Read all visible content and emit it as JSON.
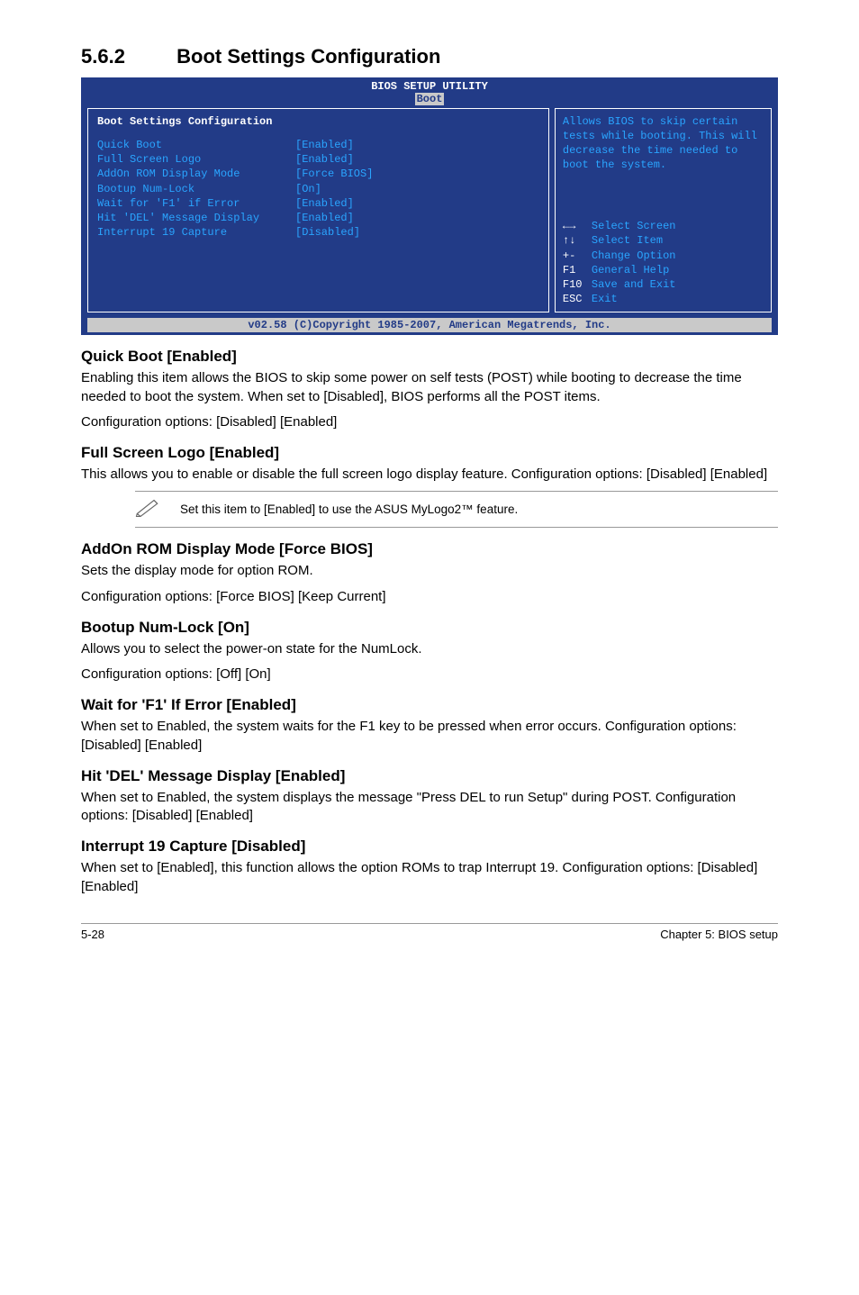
{
  "heading": {
    "number": "5.6.2",
    "title": "Boot Settings Configuration"
  },
  "bios": {
    "header_title": "BIOS SETUP UTILITY",
    "header_tab": "Boot",
    "panel_title": "Boot Settings Configuration",
    "rows": [
      {
        "label": "Quick Boot",
        "value": "[Enabled]"
      },
      {
        "label": "Full Screen Logo",
        "value": "[Enabled]"
      },
      {
        "label": "AddOn ROM Display Mode",
        "value": "[Force BIOS]"
      },
      {
        "label": "Bootup Num-Lock",
        "value": "[On]"
      },
      {
        "label": "Wait for 'F1' if Error",
        "value": "[Enabled]"
      },
      {
        "label": "Hit 'DEL' Message Display",
        "value": "[Enabled]"
      },
      {
        "label": "Interrupt 19 Capture",
        "value": "[Disabled]"
      }
    ],
    "help_text": "Allows BIOS to skip certain tests while booting. This will decrease the time needed to boot the system.",
    "keys": [
      {
        "k": "←→",
        "d": "Select Screen"
      },
      {
        "k": "↑↓",
        "d": "Select Item"
      },
      {
        "k": "+-",
        "d": "Change Option"
      },
      {
        "k": "F1",
        "d": "General Help"
      },
      {
        "k": "F10",
        "d": "Save and Exit"
      },
      {
        "k": "ESC",
        "d": "Exit"
      }
    ],
    "footer": "v02.58 (C)Copyright 1985-2007, American Megatrends, Inc."
  },
  "sections": [
    {
      "title": "Quick Boot [Enabled]",
      "paragraphs": [
        "Enabling this item allows the BIOS to skip some power on self tests (POST) while booting to decrease the time needed to boot the system. When set to [Disabled], BIOS performs all the POST items.",
        "Configuration options: [Disabled] [Enabled]"
      ]
    },
    {
      "title": "Full Screen Logo [Enabled]",
      "paragraphs": [
        "This allows you to enable or disable the full screen logo display feature. Configuration options: [Disabled] [Enabled]"
      ]
    }
  ],
  "note": "Set this item to [Enabled] to use the ASUS MyLogo2™ feature.",
  "sections2": [
    {
      "title": "AddOn ROM Display Mode [Force BIOS]",
      "paragraphs": [
        "Sets the display mode for option ROM.",
        "Configuration options: [Force BIOS] [Keep Current]"
      ]
    },
    {
      "title": "Bootup Num-Lock [On]",
      "paragraphs": [
        "Allows you to select the power-on state for the NumLock.",
        "Configuration options: [Off] [On]"
      ]
    },
    {
      "title": "Wait for 'F1' If Error [Enabled]",
      "paragraphs": [
        "When set to Enabled, the system waits for the F1 key to be pressed when error occurs. Configuration options: [Disabled] [Enabled]"
      ]
    },
    {
      "title": "Hit 'DEL' Message Display [Enabled]",
      "paragraphs": [
        "When set to Enabled, the system displays the message \"Press DEL to run Setup\" during POST. Configuration options: [Disabled] [Enabled]"
      ]
    },
    {
      "title": "Interrupt 19 Capture [Disabled]",
      "paragraphs": [
        "When set to [Enabled], this function allows the option ROMs to trap Interrupt 19. Configuration options: [Disabled] [Enabled]"
      ]
    }
  ],
  "footer": {
    "left": "5-28",
    "right": "Chapter 5: BIOS setup"
  }
}
